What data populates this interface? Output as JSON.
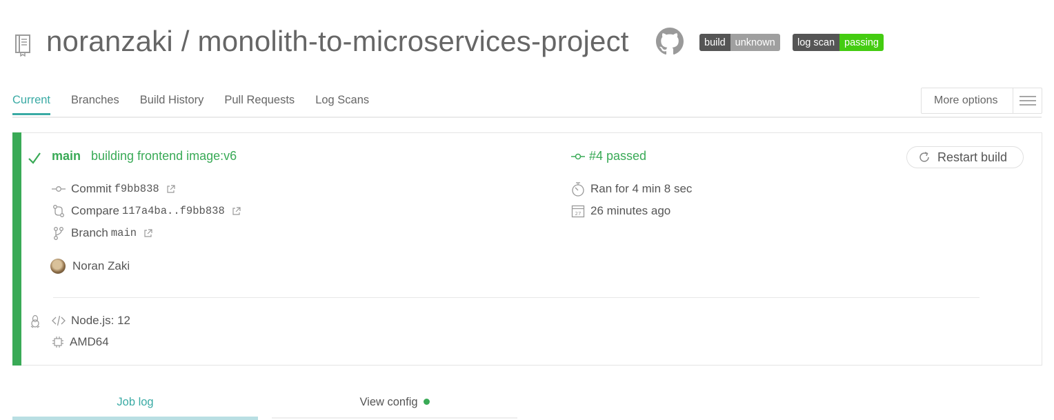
{
  "header": {
    "owner": "noranzaki",
    "separator": "/",
    "repo": "monolith-to-microservices-project",
    "badges": [
      {
        "left": "build",
        "right": "unknown",
        "right_color": "#9f9f9f"
      },
      {
        "left": "log scan",
        "right": "passing",
        "right_color": "#44cc11"
      }
    ]
  },
  "tabs": {
    "items": [
      "Current",
      "Branches",
      "Build History",
      "Pull Requests",
      "Log Scans"
    ],
    "active": "Current",
    "more_options": "More options"
  },
  "build": {
    "branch": "main",
    "commit_message": "building frontend image:v6",
    "status": "#4 passed",
    "restart_label": "Restart build",
    "commit_label": "Commit",
    "commit_sha": "f9bb838",
    "compare_label": "Compare",
    "compare_range": "117a4ba..f9bb838",
    "branch_label": "Branch",
    "branch_value": "main",
    "author": "Noran Zaki",
    "duration": "Ran for 4 min 8 sec",
    "finished": "26 minutes ago",
    "calendar_day": "27",
    "language": "Node.js: 12",
    "arch": "AMD64"
  },
  "bottom_tabs": {
    "job_log": "Job log",
    "view_config": "View config"
  },
  "colors": {
    "passed": "#39aa56",
    "accent": "#39aaa4"
  }
}
